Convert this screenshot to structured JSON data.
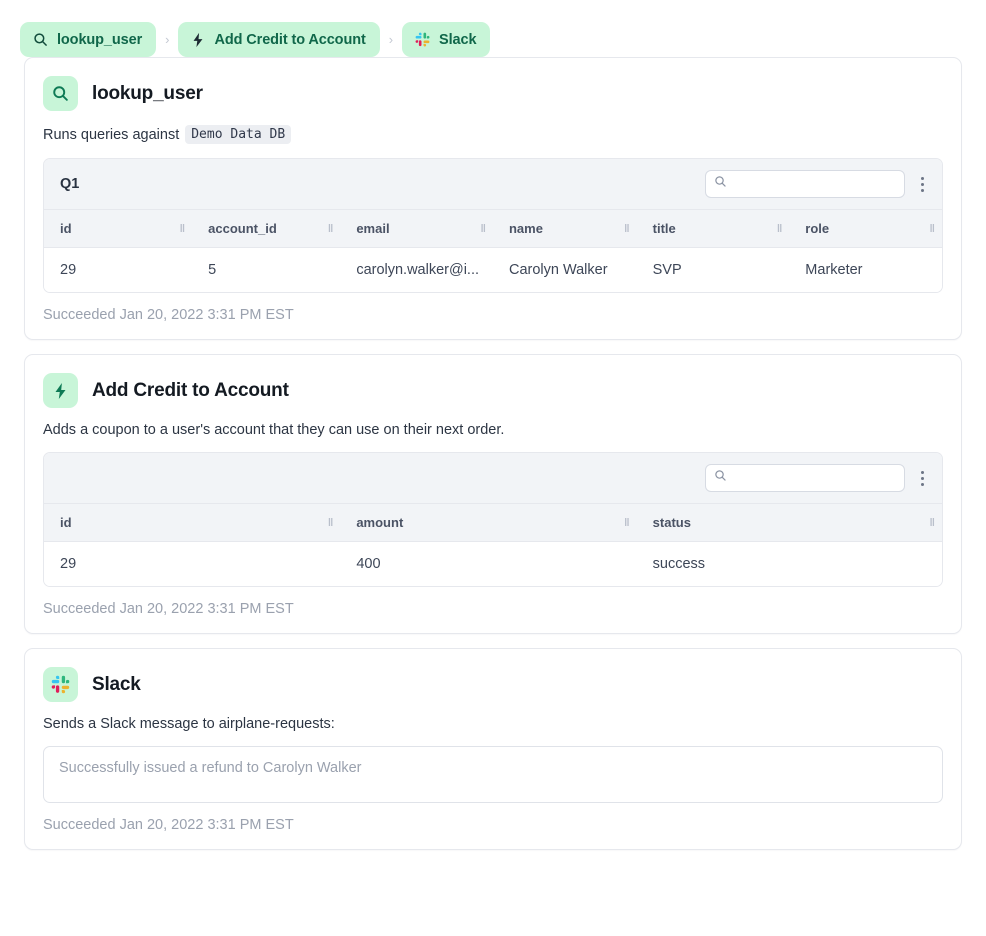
{
  "breadcrumb": {
    "items": [
      {
        "label": "lookup_user",
        "icon": "search-icon"
      },
      {
        "label": "Add Credit to Account",
        "icon": "bolt-icon"
      },
      {
        "label": "Slack",
        "icon": "slack-icon"
      }
    ],
    "separator": "›"
  },
  "theme": {
    "accent_bg": "#c8f5d8",
    "accent_text": "#10674a",
    "card_border": "#e6e8ed",
    "header_bg": "#f2f4f7",
    "muted_text": "#9aa1ae"
  },
  "cards": [
    {
      "id": "lookup-user",
      "icon": "search-icon",
      "title": "lookup_user",
      "description_prefix": "Runs queries against",
      "description_code": "Demo Data DB",
      "table": {
        "name": "Q1",
        "search_placeholder": "",
        "search_value": "",
        "columns": [
          "id",
          "account_id",
          "email",
          "name",
          "title",
          "role"
        ],
        "rows": [
          [
            "29",
            "5",
            "carolyn.walker@i...",
            "Carolyn Walker",
            "SVP",
            "Marketer"
          ]
        ]
      },
      "status": "Succeeded Jan 20, 2022 3:31 PM EST"
    },
    {
      "id": "add-credit-to-account",
      "icon": "bolt-icon",
      "title": "Add Credit to Account",
      "description_prefix": "Adds a coupon to a user's account that they can use on their next order.",
      "description_code": "",
      "table": {
        "name": "",
        "search_placeholder": "",
        "search_value": "",
        "columns": [
          "id",
          "amount",
          "status"
        ],
        "rows": [
          [
            "29",
            "400",
            "success"
          ]
        ]
      },
      "status": "Succeeded Jan 20, 2022 3:31 PM EST"
    },
    {
      "id": "slack",
      "icon": "slack-icon",
      "title": "Slack",
      "description_prefix": "Sends a Slack message to airplane-requests:",
      "description_code": "",
      "message": "Successfully issued a refund to Carolyn Walker",
      "status": "Succeeded Jan 20, 2022 3:31 PM EST"
    }
  ],
  "icons": {
    "column_grip": "‖",
    "search_glyph": "search"
  }
}
